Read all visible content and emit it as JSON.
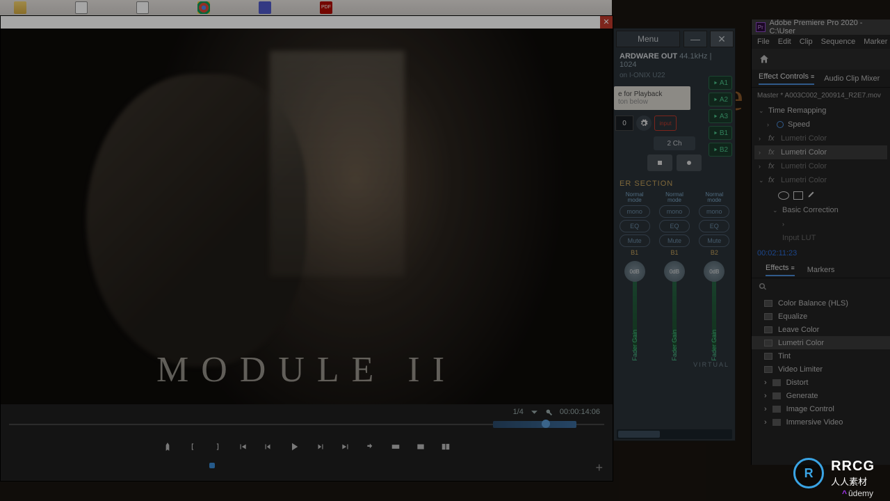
{
  "taskbar": {
    "pdf": "PDF"
  },
  "video": {
    "module_title": "MODULE II",
    "fraction": "1/4",
    "timecode": "00:00:14:06"
  },
  "audio": {
    "menu": "Menu",
    "hw_label": "ARDWARE OUT",
    "hw_rate": "44.1kHz | 1024",
    "hw_device": "on I-ONIX U22",
    "playback_line1": "e for Playback",
    "playback_line2": "ton below",
    "pb_num": "0",
    "input": "input",
    "ch": "2 Ch",
    "routes": [
      "A1",
      "A2",
      "A3",
      "B1",
      "B2"
    ],
    "section": "ER SECTION",
    "mode_l1": "Normal",
    "mode_l2": "mode",
    "mono": "mono",
    "eq": "EQ",
    "mute": "Mute",
    "strip_labels": [
      "B1",
      "B1",
      "B2"
    ],
    "db": "0dB",
    "fader": "Fader Gain",
    "virtual": "VIRTUAL"
  },
  "premiere": {
    "title": "Adobe Premiere Pro 2020 - C:\\User",
    "menus": [
      "File",
      "Edit",
      "Clip",
      "Sequence",
      "Marker"
    ],
    "tabs": {
      "effect_controls": "Effect Controls",
      "audio_clip_mixer": "Audio Clip Mixer"
    },
    "master": "Master * A003C002_200914_R2E7.mov",
    "tree": {
      "time_remapping": "Time Remapping",
      "speed": "Speed",
      "lumetri": "Lumetri Color",
      "basic_correction": "Basic Correction",
      "input_lut": "Input LUT"
    },
    "timecode": "00:02:11:23",
    "tabs2": {
      "effects": "Effects",
      "markers": "Markers"
    },
    "fx": [
      "Color Balance (HLS)",
      "Equalize",
      "Leave Color",
      "Lumetri Color",
      "Tint",
      "Video Limiter"
    ],
    "folders": [
      "Distort",
      "Generate",
      "Image Control",
      "Immersive Video"
    ]
  },
  "watermark": {
    "logo": "R",
    "en": "RRCG",
    "cn": "人人素材",
    "udemy": "ûdemy"
  }
}
